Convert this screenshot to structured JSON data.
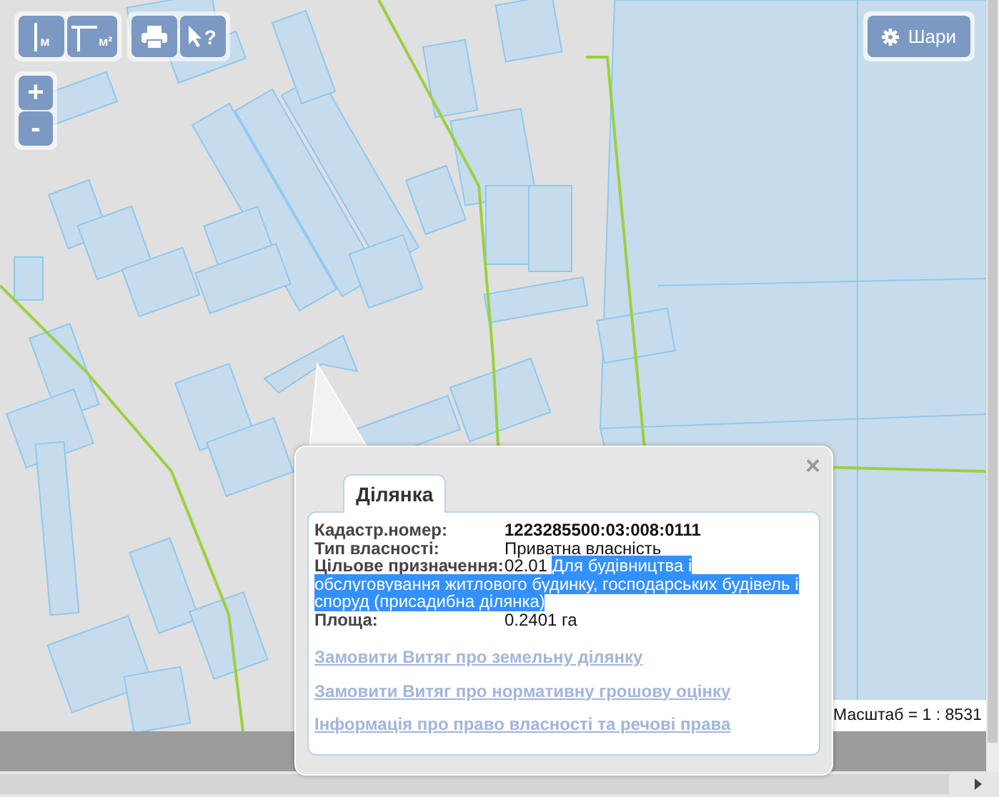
{
  "toolbar": {
    "groups": [
      {
        "buttons": [
          {
            "kind": "line",
            "label": "м"
          },
          {
            "kind": "area",
            "label": "м²"
          }
        ]
      },
      {
        "buttons": [
          {
            "kind": "print"
          },
          {
            "kind": "identify",
            "label": "?"
          }
        ]
      }
    ]
  },
  "zoom": {
    "in": "+",
    "out": "-"
  },
  "layers_button": {
    "label": "Шари"
  },
  "popup": {
    "close": "×",
    "tabs": [
      {
        "label": "Ділянка",
        "selected": true
      }
    ],
    "fields": [
      {
        "label": "Кадастр.номер:",
        "value": "1223285500:03:008:0111",
        "bold": true
      },
      {
        "label": "Тип власності:",
        "value": "Приватна власність",
        "bold": false
      },
      {
        "label": "Цільове призначення:",
        "value": "02.01",
        "selected_text": [
          "Для будівництва і",
          "обслуговування житлового будинку, господарських будівель і",
          "споруд (присадибна ділянка)"
        ],
        "bold": false
      },
      {
        "label": "Площа:",
        "value": "0.2401 га",
        "bold": false
      }
    ],
    "links": [
      "Замовити Витяг про земельну ділянку",
      "Замовити Витяг про нормативну грошову оцінку",
      "Інформація про право власності та речові права"
    ]
  },
  "scale": "Масштаб = 1 : 8531"
}
